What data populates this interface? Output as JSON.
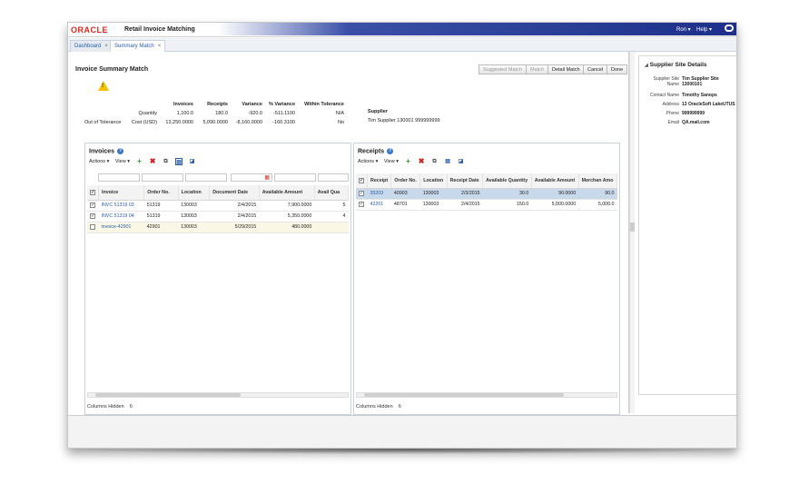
{
  "app": {
    "logo": "ORACLE",
    "title": "Retail Invoice Matching",
    "user_menu": "Ron ▾",
    "help_menu": "Help ▾"
  },
  "tabs": [
    {
      "label": "Dashboard"
    },
    {
      "label": "Summary Match"
    }
  ],
  "page": {
    "title": "Invoice Summary Match"
  },
  "buttons": {
    "suggested": "Suggested Match",
    "match": "Match",
    "detail": "Detail Match",
    "cancel": "Cancel",
    "done": "Done"
  },
  "summary": {
    "status": "Out of Tolerance",
    "headers": [
      "Invoices",
      "Receipts",
      "Variance",
      "% Variance",
      "Within Tolerance"
    ],
    "row_labels": [
      "Quantity",
      "Cost (USD)"
    ],
    "invoices": [
      "1,100.0",
      "13,250.0000"
    ],
    "receipts": [
      "180.0",
      "5,090.0000"
    ],
    "variance": [
      "-920.0",
      "-8,160.0000"
    ],
    "pct_variance": [
      "-511.1100",
      "-160.3100"
    ],
    "within_tolerance": [
      "N/A",
      "No"
    ],
    "supplier_label": "Supplier",
    "supplier_value": "Tim Supplier 130001 999999999"
  },
  "invoices_panel": {
    "title": "Invoices",
    "actions": "Actions ▾",
    "view": "View ▾",
    "columns": [
      "Invoice",
      "Order No.",
      "Location",
      "Document Date",
      "Available Amount",
      "Avail Qua"
    ],
    "rows": [
      {
        "invoice": "INVC 51319 03",
        "order": "51319",
        "location": "130003",
        "date": "2/4/2015",
        "amount": "7,900.0000",
        "qty": "5",
        "checked": "✓"
      },
      {
        "invoice": "INVC 51319 04",
        "order": "51319",
        "location": "130003",
        "date": "2/4/2015",
        "amount": "5,350.0000",
        "qty": "4",
        "checked": "✓"
      },
      {
        "invoice": "invoice-42901",
        "order": "42901",
        "location": "130003",
        "date": "5/29/2015",
        "amount": "480.0000",
        "qty": "",
        "checked": ""
      }
    ],
    "columns_hidden_label": "Columns Hidden",
    "columns_hidden_count": "6"
  },
  "receipts_panel": {
    "title": "Receipts",
    "actions": "Actions ▾",
    "view": "View ▾",
    "columns": [
      "Receipt",
      "Order No.",
      "Location",
      "Receipt Date",
      "Available Quantity",
      "Available Amount",
      "Merchan Amo"
    ],
    "rows": [
      {
        "receipt": "35203",
        "order": "40903",
        "location": "130003",
        "date": "2/3/2015",
        "qty": "30.0",
        "amount": "90.0000",
        "merch": "90.0",
        "checked": "✓"
      },
      {
        "receipt": "42201",
        "order": "48701",
        "location": "130003",
        "date": "2/4/2015",
        "qty": "150.0",
        "amount": "5,000.0000",
        "merch": "5,000.0",
        "checked": "✓"
      }
    ],
    "columns_hidden_label": "Columns Hidden",
    "columns_hidden_count": "6"
  },
  "supplier_site": {
    "title": "Supplier Site Details",
    "fields": [
      {
        "label": "Supplier Site Name",
        "value": "Tim Supplier Site 13000101"
      },
      {
        "label": "Contact Name",
        "value": "Timothy Sanops"
      },
      {
        "label": "Address",
        "value": "13 OracleSoft LakeUTUS"
      },
      {
        "label": "Phone",
        "value": "999999999"
      },
      {
        "label": "Email",
        "value": "QA.mail.com"
      }
    ]
  },
  "colors": {
    "brand": "#e2231a",
    "header_blue": "#1d2f8a",
    "link": "#2a5da8",
    "selected_row": "#c9d9ec"
  }
}
